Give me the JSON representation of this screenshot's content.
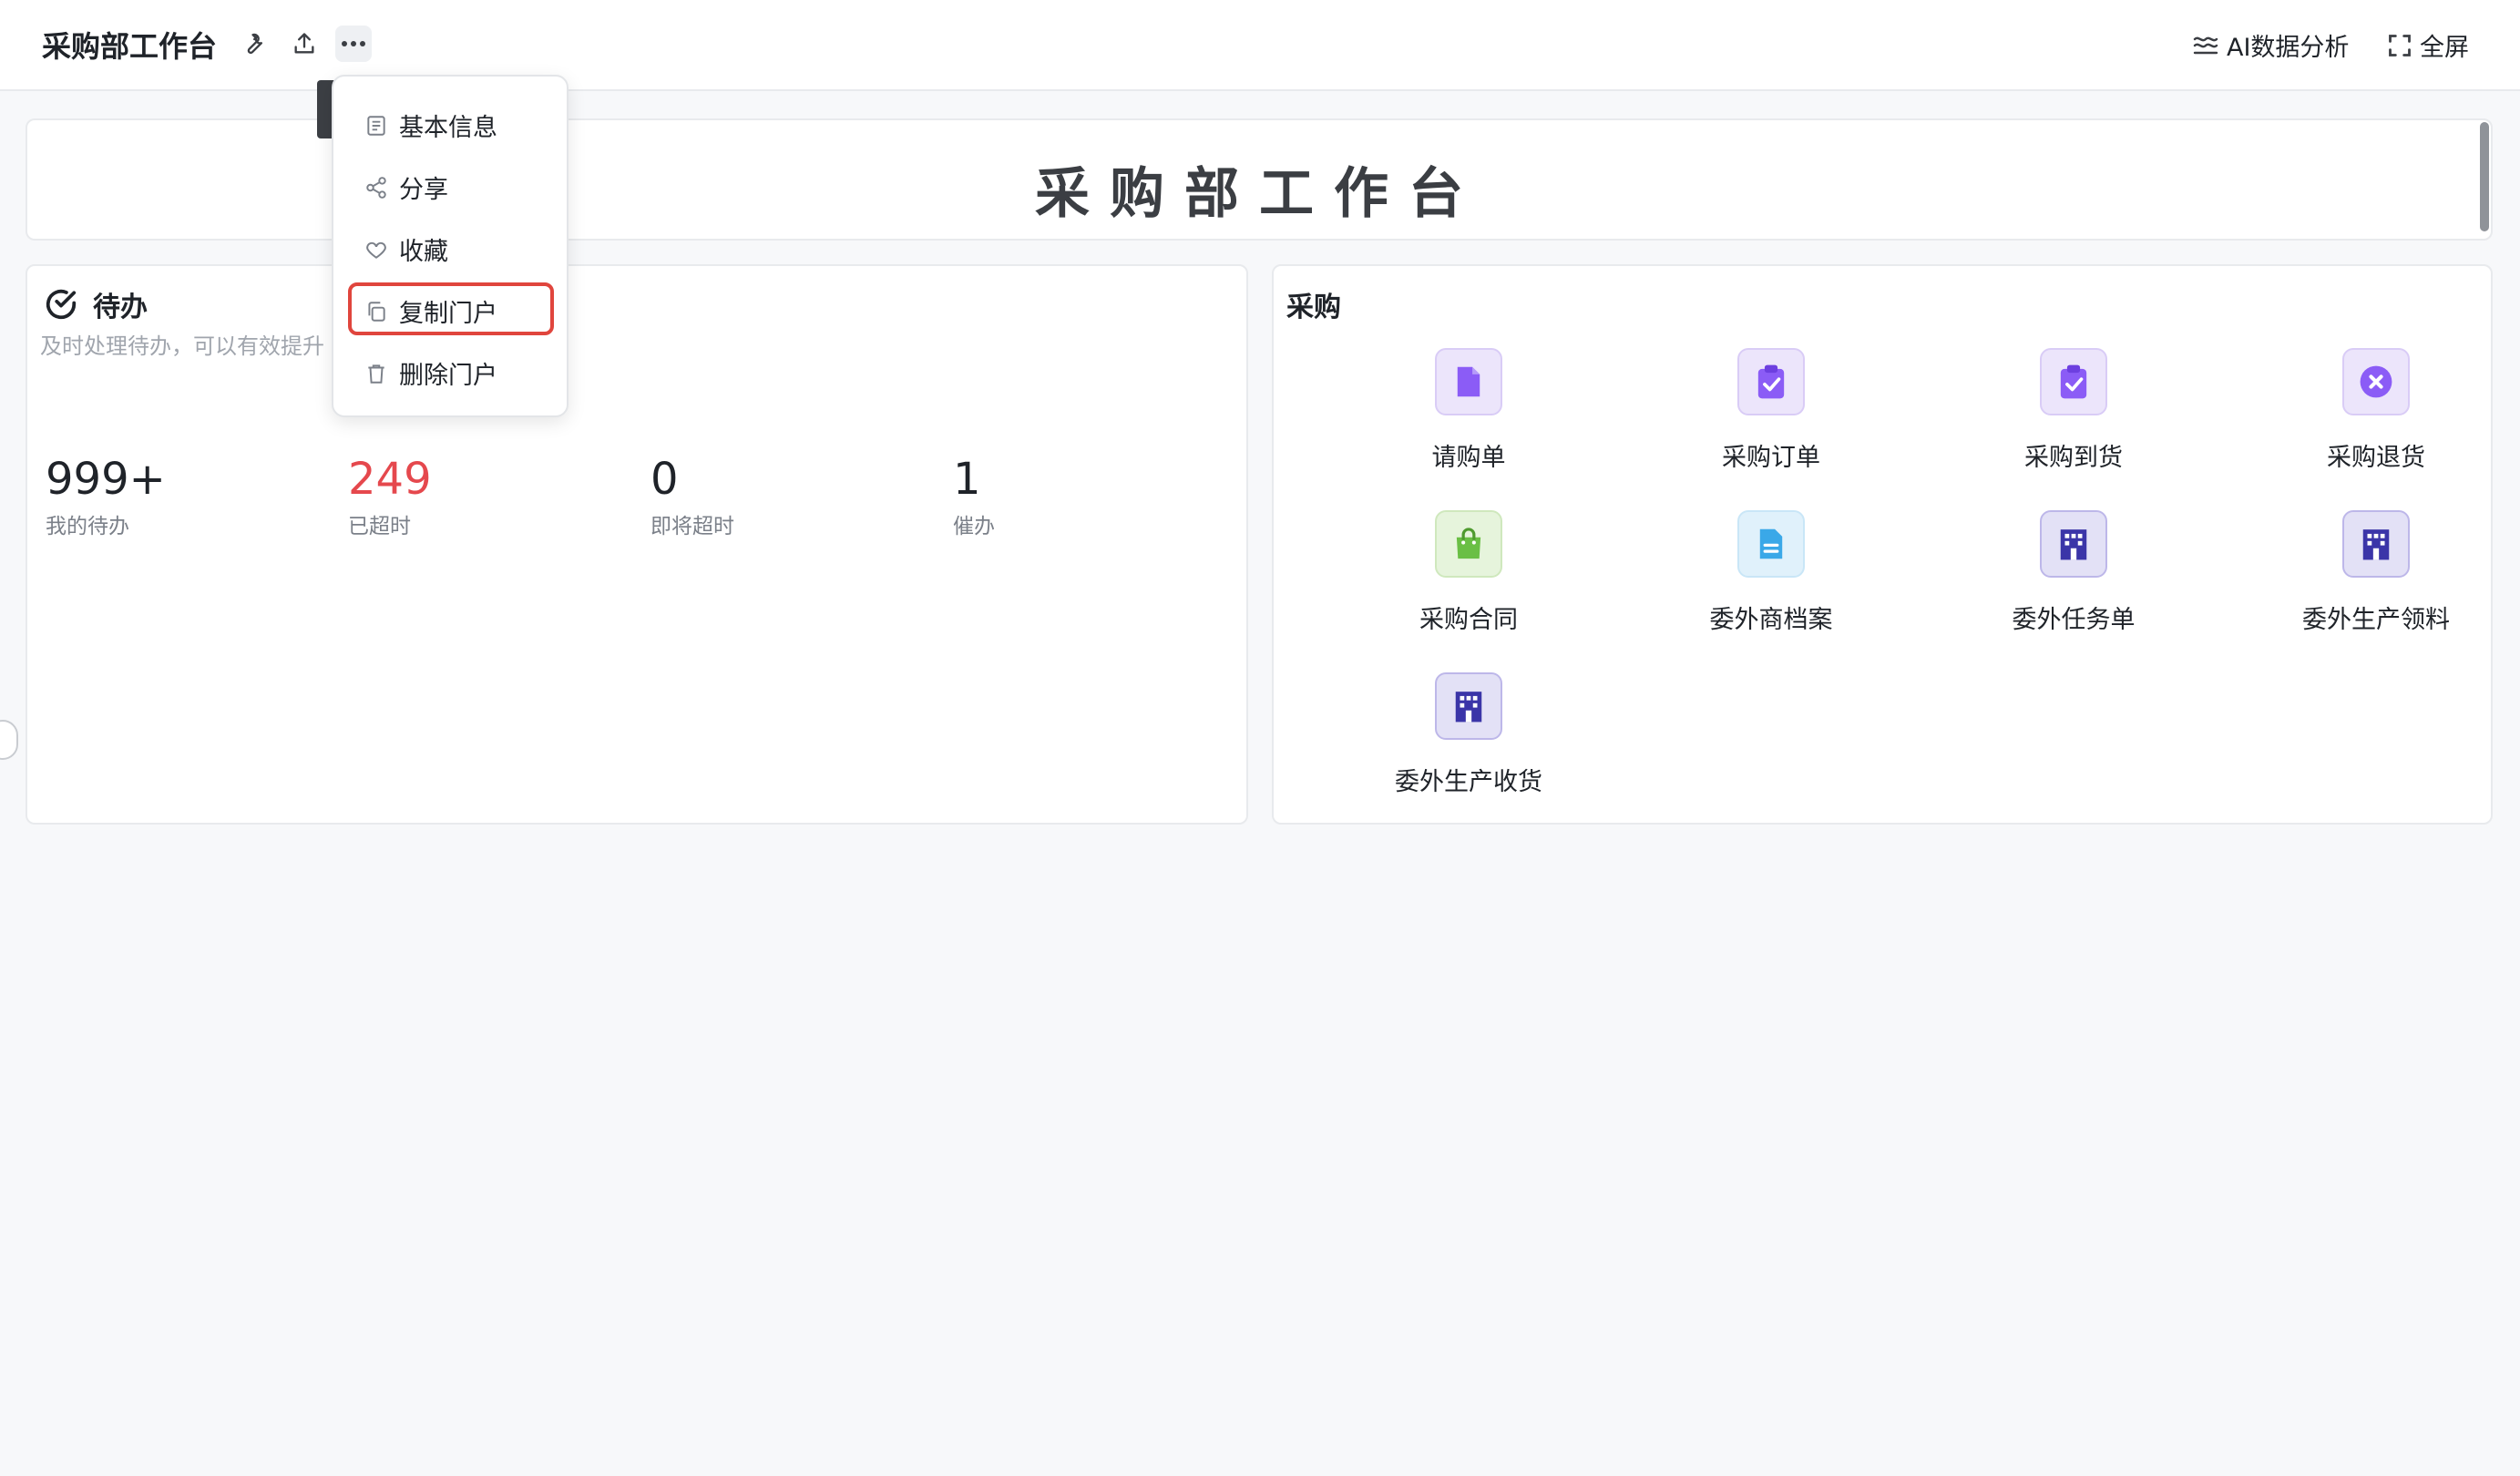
{
  "header": {
    "title": "采购部工作台",
    "icons": [
      "wrench-icon",
      "upload-icon",
      "more-icon"
    ],
    "ai_label": "AI数据分析",
    "fullscreen_label": "全屏"
  },
  "banner": {
    "title": "采购部工作台"
  },
  "menu": {
    "items": [
      {
        "label": "基本信息",
        "icon": "info-doc-icon"
      },
      {
        "label": "分享",
        "icon": "share-icon"
      },
      {
        "label": "收藏",
        "icon": "heart-icon"
      },
      {
        "label": "复制门户",
        "icon": "copy-icon"
      },
      {
        "label": "删除门户",
        "icon": "trash-icon"
      }
    ],
    "highlighted": "复制门户",
    "highlight_color": "#e0453d"
  },
  "todo": {
    "title": "待办",
    "subtitle": "及时处理待办，可以有效提升",
    "stats": [
      {
        "value": "999+",
        "label": "我的待办"
      },
      {
        "value": "249",
        "label": "已超时",
        "color": "#e5484d"
      },
      {
        "value": "0",
        "label": "即将超时"
      },
      {
        "value": "1",
        "label": "催办"
      }
    ]
  },
  "purchase": {
    "title": "采购",
    "items": [
      {
        "label": "请购单",
        "icon": "document-icon",
        "color": "#8b5cf6"
      },
      {
        "label": "采购订单",
        "icon": "clipboard-check-icon",
        "color": "#8b5cf6"
      },
      {
        "label": "采购到货",
        "icon": "clipboard-check-icon",
        "color": "#8b5cf6"
      },
      {
        "label": "采购退货",
        "icon": "close-circle-icon",
        "color": "#8b5cf6"
      },
      {
        "label": "采购合同",
        "icon": "shopping-bag-icon",
        "color": "#6abf45"
      },
      {
        "label": "委外商档案",
        "icon": "file-text-icon",
        "color": "#3aa8e8"
      },
      {
        "label": "委外任务单",
        "icon": "building-icon",
        "color": "#3b35a8"
      },
      {
        "label": "委外生产领料",
        "icon": "building-icon",
        "color": "#3b35a8"
      },
      {
        "label": "委外生产收货",
        "icon": "building-icon",
        "color": "#3b35a8"
      }
    ]
  }
}
